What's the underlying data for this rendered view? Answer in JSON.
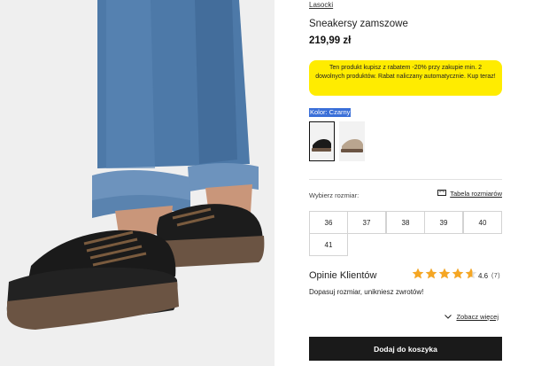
{
  "product": {
    "brand": "Lasocki",
    "name": "Sneakersy zamszowe",
    "price": "219,99 zł",
    "promo_text": "Ten produkt kupisz z rabatem -20% przy zakupie min. 2 dowolnych produktów. Rabat naliczany automatycznie. Kup teraz!"
  },
  "color": {
    "label": "Kolor: Czarny",
    "swatches": [
      {
        "name": "black",
        "selected": true
      },
      {
        "name": "beige",
        "selected": false
      }
    ]
  },
  "sizes": {
    "label": "Wybierz rozmiar:",
    "table_link": "Tabela rozmiarów",
    "options": [
      "36",
      "37",
      "38",
      "39",
      "40",
      "41"
    ]
  },
  "reviews": {
    "title": "Opinie Klientów",
    "rating": "4.6",
    "count": "(7)",
    "stars_filled": 4.6,
    "snippet": "Dopasuj rozmiar, unikniesz zwrotów!",
    "see_more": "Zobacz więcej"
  },
  "cart": {
    "add_label": "Dodaj do koszyka"
  },
  "colors": {
    "promo_bg": "#ffec00",
    "star": "#f5a623",
    "button_bg": "#1a1a1a",
    "highlight": "#3a6fd8"
  }
}
